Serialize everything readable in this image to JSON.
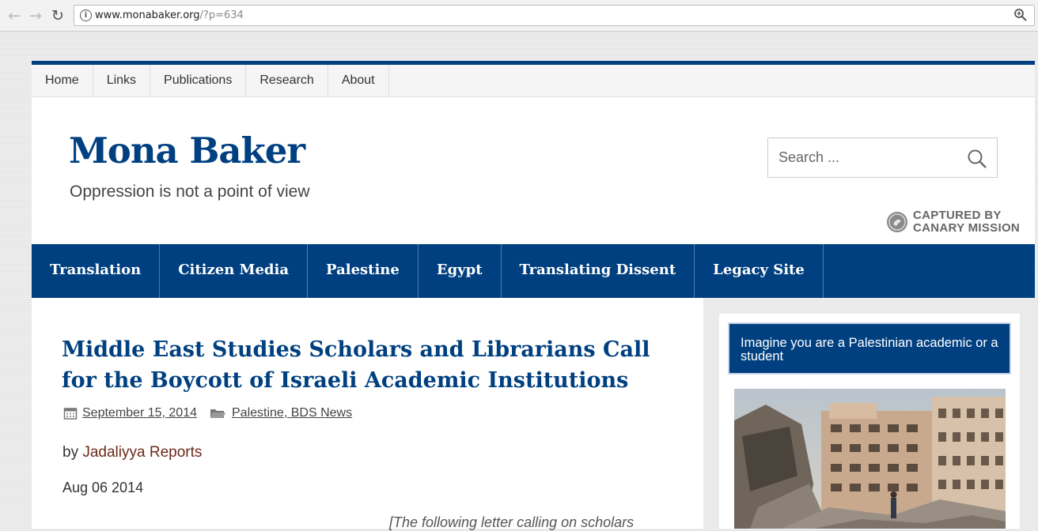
{
  "browser": {
    "url_domain": "www.monabaker.org",
    "url_path": "/?p=634",
    "back_icon": "arrow-left",
    "forward_icon": "arrow-right",
    "reload_icon": "reload"
  },
  "topnav": {
    "items": [
      {
        "label": "Home"
      },
      {
        "label": "Links"
      },
      {
        "label": "Publications"
      },
      {
        "label": "Research"
      },
      {
        "label": "About"
      }
    ]
  },
  "header": {
    "site_title": "Mona Baker",
    "tagline": "Oppression is not a point of view",
    "search_placeholder": "Search ...",
    "watermark_line1": "CAPTURED BY",
    "watermark_line2": "CANARY MISSION"
  },
  "mainnav": {
    "items": [
      {
        "label": "Translation"
      },
      {
        "label": "Citizen Media"
      },
      {
        "label": "Palestine"
      },
      {
        "label": "Egypt"
      },
      {
        "label": "Translating Dissent"
      },
      {
        "label": "Legacy Site"
      }
    ]
  },
  "post": {
    "title": "Middle East Studies Scholars and Librarians Call for the Boycott of Israeli Academic Institutions",
    "date": "September 15, 2014",
    "category_1": "Palestine",
    "category_sep": ", ",
    "category_2": "BDS News",
    "by_prefix": "by ",
    "author": "Jadaliyya Reports",
    "source_date": "Aug 06 2014",
    "excerpt_start": "[The following letter calling on scholars"
  },
  "sidebar": {
    "widget_title": "Imagine you are a Palestinian academic or a student"
  },
  "colors": {
    "brand_blue": "#004080",
    "author_link": "#6b2a1a",
    "sidebar_bg": "#eaeaea"
  }
}
